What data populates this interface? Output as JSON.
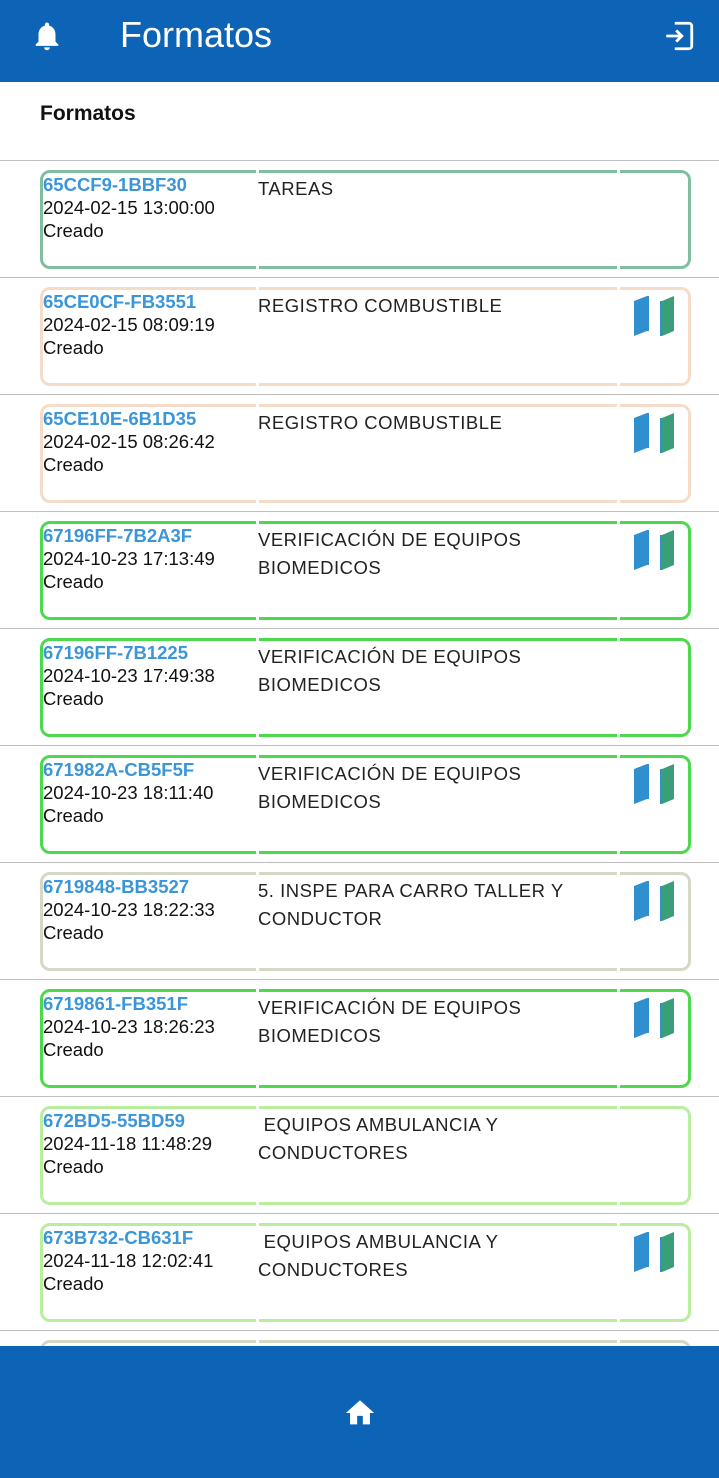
{
  "header": {
    "title": "Formatos",
    "bell_icon": "bell-icon",
    "logout_icon": "logout-icon"
  },
  "section": {
    "title": "Formatos"
  },
  "colors": {
    "primary": "#0d63b5",
    "code_text": "#3a96d8",
    "map_blue": "#2f8fcf",
    "map_green": "#3a9e78"
  },
  "items": [
    {
      "code": "65CCF9-1BBF30",
      "date": "2024-02-15 13:00:00",
      "status": "Creado",
      "name": "TAREAS",
      "border": "#7fbfa0",
      "map": false
    },
    {
      "code": "65CE0CF-FB3551",
      "date": "2024-02-15 08:09:19",
      "status": "Creado",
      "name": "REGISTRO COMBUSTIBLE",
      "border": "#f5dcc8",
      "map": true
    },
    {
      "code": "65CE10E-6B1D35",
      "date": "2024-02-15 08:26:42",
      "status": "Creado",
      "name": "REGISTRO COMBUSTIBLE",
      "border": "#f5dcc8",
      "map": true
    },
    {
      "code": "67196FF-7B2A3F",
      "date": "2024-10-23 17:13:49",
      "status": "Creado",
      "name": "VERIFICACIÓN DE EQUIPOS\nBIOMEDICOS",
      "border": "#4cd94c",
      "map": true
    },
    {
      "code": "67196FF-7B1225",
      "date": "2024-10-23 17:49:38",
      "status": "Creado",
      "name": "VERIFICACIÓN DE EQUIPOS\nBIOMEDICOS",
      "border": "#4cd94c",
      "map": false
    },
    {
      "code": "671982A-CB5F5F",
      "date": "2024-10-23 18:11:40",
      "status": "Creado",
      "name": "VERIFICACIÓN DE EQUIPOS\nBIOMEDICOS",
      "border": "#4cd94c",
      "map": true
    },
    {
      "code": "6719848-BB3527",
      "date": "2024-10-23 18:22:33",
      "status": "Creado",
      "name": "5. INSPE PARA CARRO TALLER Y\nCONDUCTOR",
      "border": "#d5d8c4",
      "map": true
    },
    {
      "code": "6719861-FB351F",
      "date": "2024-10-23 18:26:23",
      "status": "Creado",
      "name": "VERIFICACIÓN DE EQUIPOS\nBIOMEDICOS",
      "border": "#4cd94c",
      "map": true
    },
    {
      "code": "672BD5-55BD59",
      "date": "2024-11-18 11:48:29",
      "status": "Creado",
      "name": " EQUIPOS AMBULANCIA Y\nCONDUCTORES",
      "border": "#b9eda0",
      "map": false
    },
    {
      "code": "673B732-CB631F",
      "date": "2024-11-18 12:02:41",
      "status": "Creado",
      "name": " EQUIPOS AMBULANCIA Y\nCONDUCTORES",
      "border": "#b9eda0",
      "map": true
    },
    {
      "code": "",
      "date": "",
      "status": "",
      "name": "",
      "border": "#d5d8c4",
      "map": false
    }
  ],
  "bottom_nav": {
    "home_icon": "home-icon"
  }
}
